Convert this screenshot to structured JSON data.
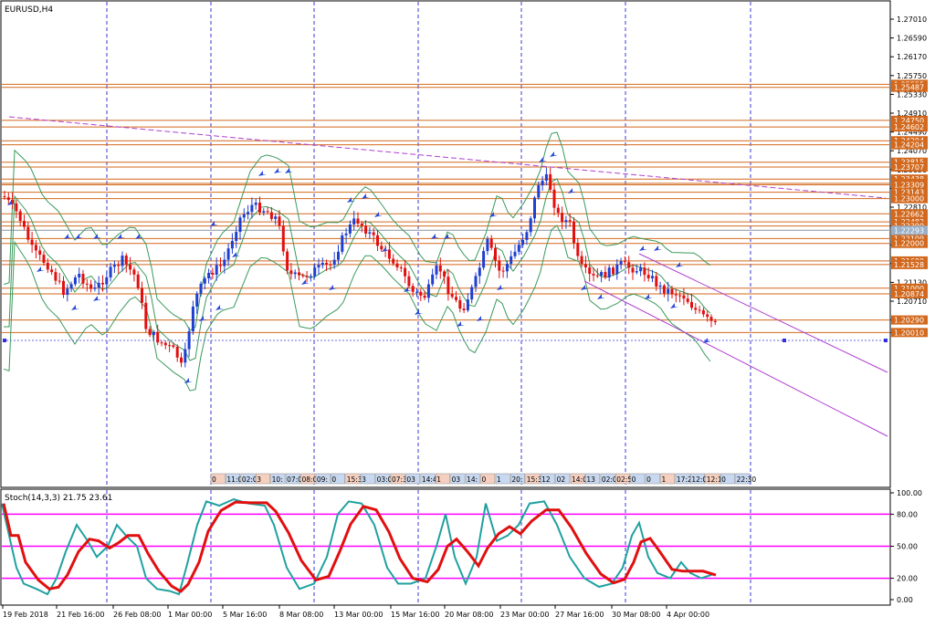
{
  "main": {
    "title": "EURUSD,H4",
    "price_ticks": [
      "1.27010",
      "1.26590",
      "1.26170",
      "1.25750",
      "1.25330",
      "1.24910",
      "1.24490",
      "1.24070",
      "1.23650",
      "1.23230",
      "1.22810",
      "1.22390",
      "1.21970",
      "1.21550",
      "1.21130",
      "1.20710",
      "1.20290",
      "1.20010"
    ],
    "level_labels": [
      "1.25555",
      "1.25487",
      "1.24750",
      "1.24602",
      "1.24294",
      "1.24204",
      "1.23815",
      "1.23707",
      "1.23438",
      "1.23343",
      "1.23309",
      "1.23143",
      "1.23000",
      "1.22662",
      "1.22482",
      "1.22390",
      "1.22293",
      "1.22109",
      "1.22000",
      "1.21609",
      "1.21528",
      "1.21000",
      "1.20874",
      "1.20290",
      "1.20010"
    ],
    "current_price": "1.22293",
    "time_tags": [
      "0",
      "11:0",
      "02:0",
      "3",
      "10:",
      "07:0",
      "08:0",
      "09:",
      "0",
      "15:30",
      "3",
      "03:00",
      "07:3",
      "03",
      "14:45",
      "1",
      "03",
      "14:",
      "0",
      "1",
      "20:",
      "15:3",
      "12",
      "02",
      "14:00",
      "13",
      "02:0",
      "02:5",
      "0",
      "0",
      "1",
      "17:2",
      "12:0",
      "12:1",
      "0",
      "22:30"
    ]
  },
  "stoch": {
    "title": "Stoch(14,3,3) 21.75 23.61",
    "ticks": [
      "100.00",
      "80.00",
      "50.00",
      "20.00",
      "0.00"
    ]
  },
  "time_axis": [
    "19 Feb 2018",
    "21 Feb 16:00",
    "26 Feb 08:00",
    "1 Mar 00:00",
    "5 Mar 16:00",
    "8 Mar 08:00",
    "13 Mar 00:00",
    "15 Mar 16:00",
    "20 Mar 08:00",
    "23 Mar 00:00",
    "27 Mar 16:00",
    "30 Mar 08:00",
    "4 Apr 00:00"
  ],
  "colors": {
    "bull": "#1f3fd0",
    "bear": "#e01010",
    "level": "#d2691e",
    "trend": "#b040d0",
    "band": "#3a9a5a",
    "stoch_main": "#20a0a0",
    "stoch_signal": "#e01010",
    "stoch_levels": "#ff00ff",
    "grid": "#3a3ad0"
  }
}
